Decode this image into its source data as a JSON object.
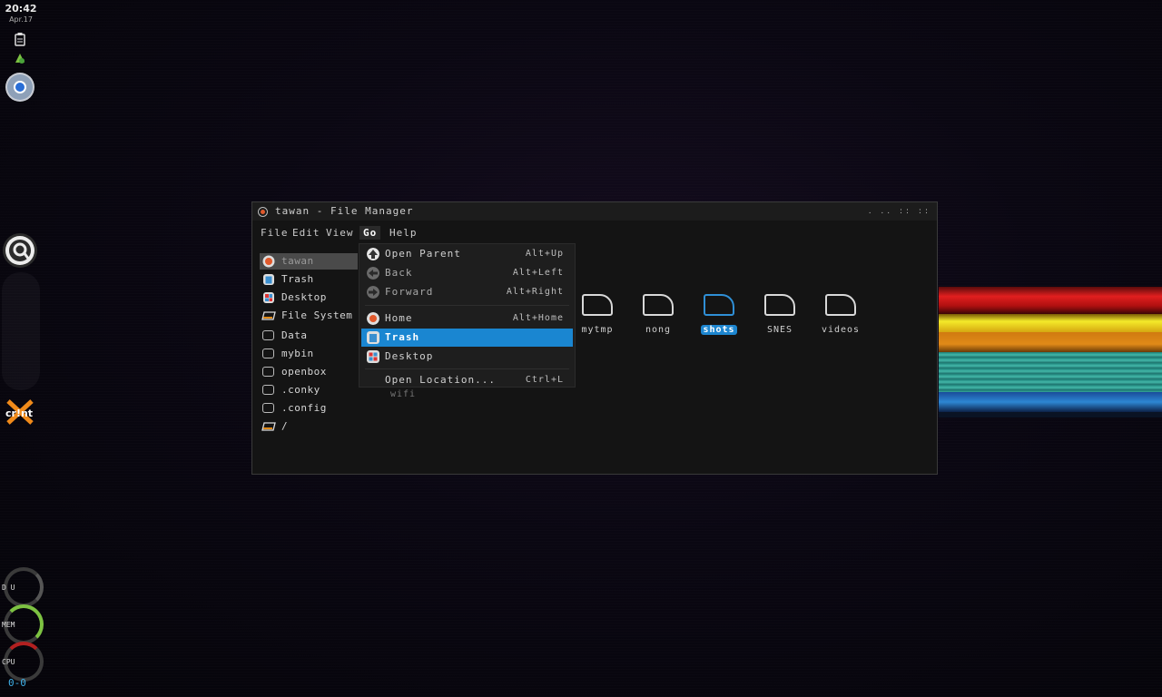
{
  "clock": {
    "time": "20:42",
    "date": "Apr.17"
  },
  "dock": {
    "crunchbang_label": "cr!nt",
    "gauges": [
      {
        "label": "D U",
        "color": "#555555"
      },
      {
        "label": "MEM",
        "color": "#7dc242"
      },
      {
        "label": "CPU",
        "color": "#b22020"
      }
    ],
    "net_label": "0-0"
  },
  "window": {
    "title": "tawan - File Manager",
    "controls": ". .. :: ::"
  },
  "menubar": [
    {
      "label": "File"
    },
    {
      "label": "Edit"
    },
    {
      "label": "View"
    },
    {
      "label": "Go"
    },
    {
      "label": "Help"
    }
  ],
  "sidebar": [
    {
      "label": "tawan"
    },
    {
      "label": "Trash"
    },
    {
      "label": "Desktop"
    },
    {
      "label": "File System"
    },
    {
      "label": "Data"
    },
    {
      "label": "mybin"
    },
    {
      "label": "openbox"
    },
    {
      "label": ".conky"
    },
    {
      "label": ".config"
    },
    {
      "label": "/"
    }
  ],
  "files": [
    {
      "label": "mytmp"
    },
    {
      "label": "nong"
    },
    {
      "label": "shots"
    },
    {
      "label": "SNES"
    },
    {
      "label": "videos"
    }
  ],
  "hidden_file": "wifi",
  "go_menu": [
    {
      "label": "Open Parent",
      "shortcut": "Alt+Up"
    },
    {
      "label": "Back",
      "shortcut": "Alt+Left"
    },
    {
      "label": "Forward",
      "shortcut": "Alt+Right"
    },
    {
      "label": "Home",
      "shortcut": "Alt+Home"
    },
    {
      "label": "Trash",
      "shortcut": ""
    },
    {
      "label": "Desktop",
      "shortcut": ""
    },
    {
      "label": "Open Location...",
      "shortcut": "Ctrl+L"
    }
  ],
  "colors": {
    "accent": "#1a86d1",
    "selection": "#4a4a4a"
  }
}
